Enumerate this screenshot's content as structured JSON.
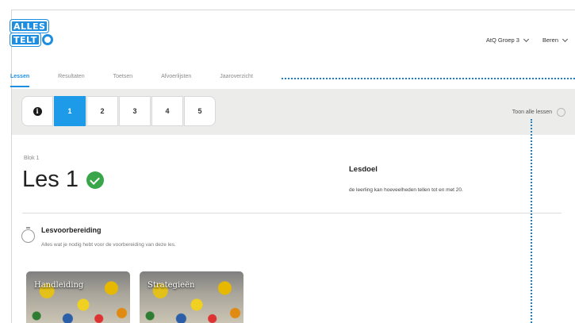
{
  "logo": {
    "line1": "ALLES",
    "line2": "TELT"
  },
  "user_menu": {
    "group": "AtQ Groep 3",
    "user": "Beren"
  },
  "tabs": [
    {
      "label": "Lessen",
      "active": true
    },
    {
      "label": "Resultaten",
      "active": false
    },
    {
      "label": "Toetsen",
      "active": false
    },
    {
      "label": "Afvoerlijsten",
      "active": false
    },
    {
      "label": "Jaaroverzicht",
      "active": false
    }
  ],
  "lesson_bar": {
    "info_icon": "i",
    "lessons": [
      "1",
      "2",
      "3",
      "4",
      "5"
    ],
    "active_lesson": "1",
    "show_all": "Toon alle lessen"
  },
  "lesson": {
    "block": "Blok 1",
    "title": "Les 1",
    "status": "completed"
  },
  "goal": {
    "heading": "Lesdoel",
    "text": "de leerling kan hoeveelheden tellen tot en met 20."
  },
  "preparation": {
    "heading": "Lesvoorbereiding",
    "text": "Alles wat je nodig hebt voor de voorbereiding van deze les."
  },
  "cards": [
    {
      "label": "Handleiding"
    },
    {
      "label": "Strategieën"
    }
  ],
  "colors": {
    "accent": "#1e9be8",
    "success": "#3aa64a",
    "annotation": "#1a7fd0"
  }
}
